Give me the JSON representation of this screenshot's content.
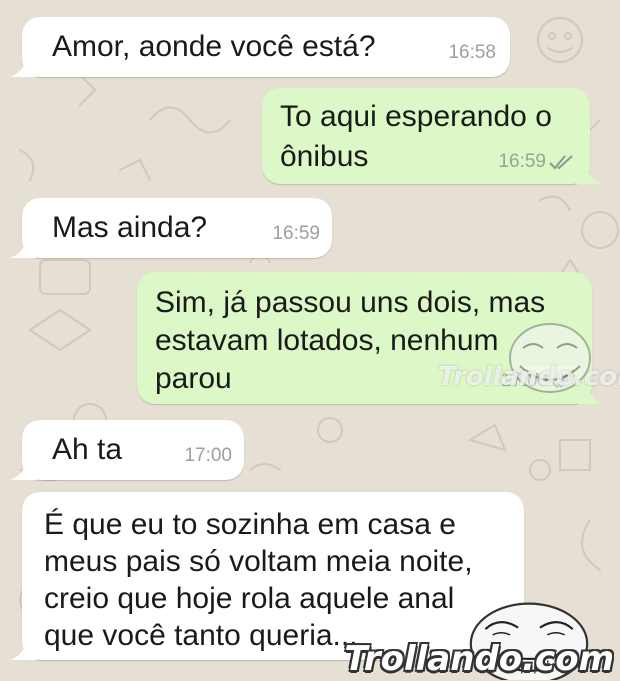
{
  "colors": {
    "wallpaper": "#e6dfd3",
    "incoming_bubble": "#ffffff",
    "outgoing_bubble": "#dcf8c6",
    "timestamp": "#9aa29a",
    "read_ticks": "#8a9a8a"
  },
  "messages": [
    {
      "direction": "incoming",
      "lines": [
        "Amor, aonde você está?"
      ],
      "time": "16:58"
    },
    {
      "direction": "outgoing",
      "lines": [
        "To aqui esperando o",
        "ônibus"
      ],
      "time": "16:59",
      "status": "double-check-icon"
    },
    {
      "direction": "incoming",
      "lines": [
        "Mas ainda?"
      ],
      "time": "16:59"
    },
    {
      "direction": "outgoing",
      "lines": [
        "Sim, já passou uns dois, mas",
        "estavam lotados, nenhum",
        "parou"
      ],
      "time": "17:00",
      "status": "double-check-icon"
    },
    {
      "direction": "incoming",
      "lines": [
        "Ah ta"
      ],
      "time": "17:00"
    },
    {
      "direction": "incoming",
      "lines": [
        "É que eu to sozinha em casa e",
        "meus pais só voltam meia noite,",
        "creio que hoje rola aquele anal",
        "que você tanto queria..."
      ],
      "time": ""
    }
  ],
  "watermarks": {
    "main": "Trollando.com",
    "faint": "Trollando.com"
  },
  "icons": {
    "read_receipt": "double-check-icon",
    "meme_face": "troll-face-icon"
  }
}
